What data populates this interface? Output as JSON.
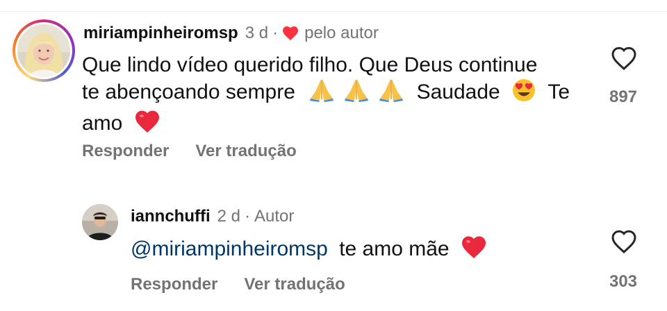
{
  "comments": [
    {
      "username": "miriampinheiromsp",
      "time": "3 d",
      "separator": "·",
      "badge": "pelo autor",
      "text_lines": [
        "Que lindo vídeo querido filho. Que Deus continue",
        "te abençoando sempre",
        "Saudade",
        "Te",
        "amo"
      ],
      "emojis": [
        "folded-hands",
        "folded-hands",
        "folded-hands",
        "heart-eyes",
        "red-heart"
      ],
      "reply_label": "Responder",
      "translate_label": "Ver tradução",
      "like_count": "897"
    },
    {
      "username": "iannchuffi",
      "time": "2 d",
      "separator": "·",
      "badge": "Autor",
      "mention": "@miriampinheiromsp",
      "text": "te amo mãe",
      "emojis": [
        "red-heart"
      ],
      "reply_label": "Responder",
      "translate_label": "Ver tradução",
      "like_count": "303"
    }
  ],
  "colors": {
    "text": "#111111",
    "muted": "#737373",
    "mention": "#00376b",
    "heart": "#ff3040"
  }
}
